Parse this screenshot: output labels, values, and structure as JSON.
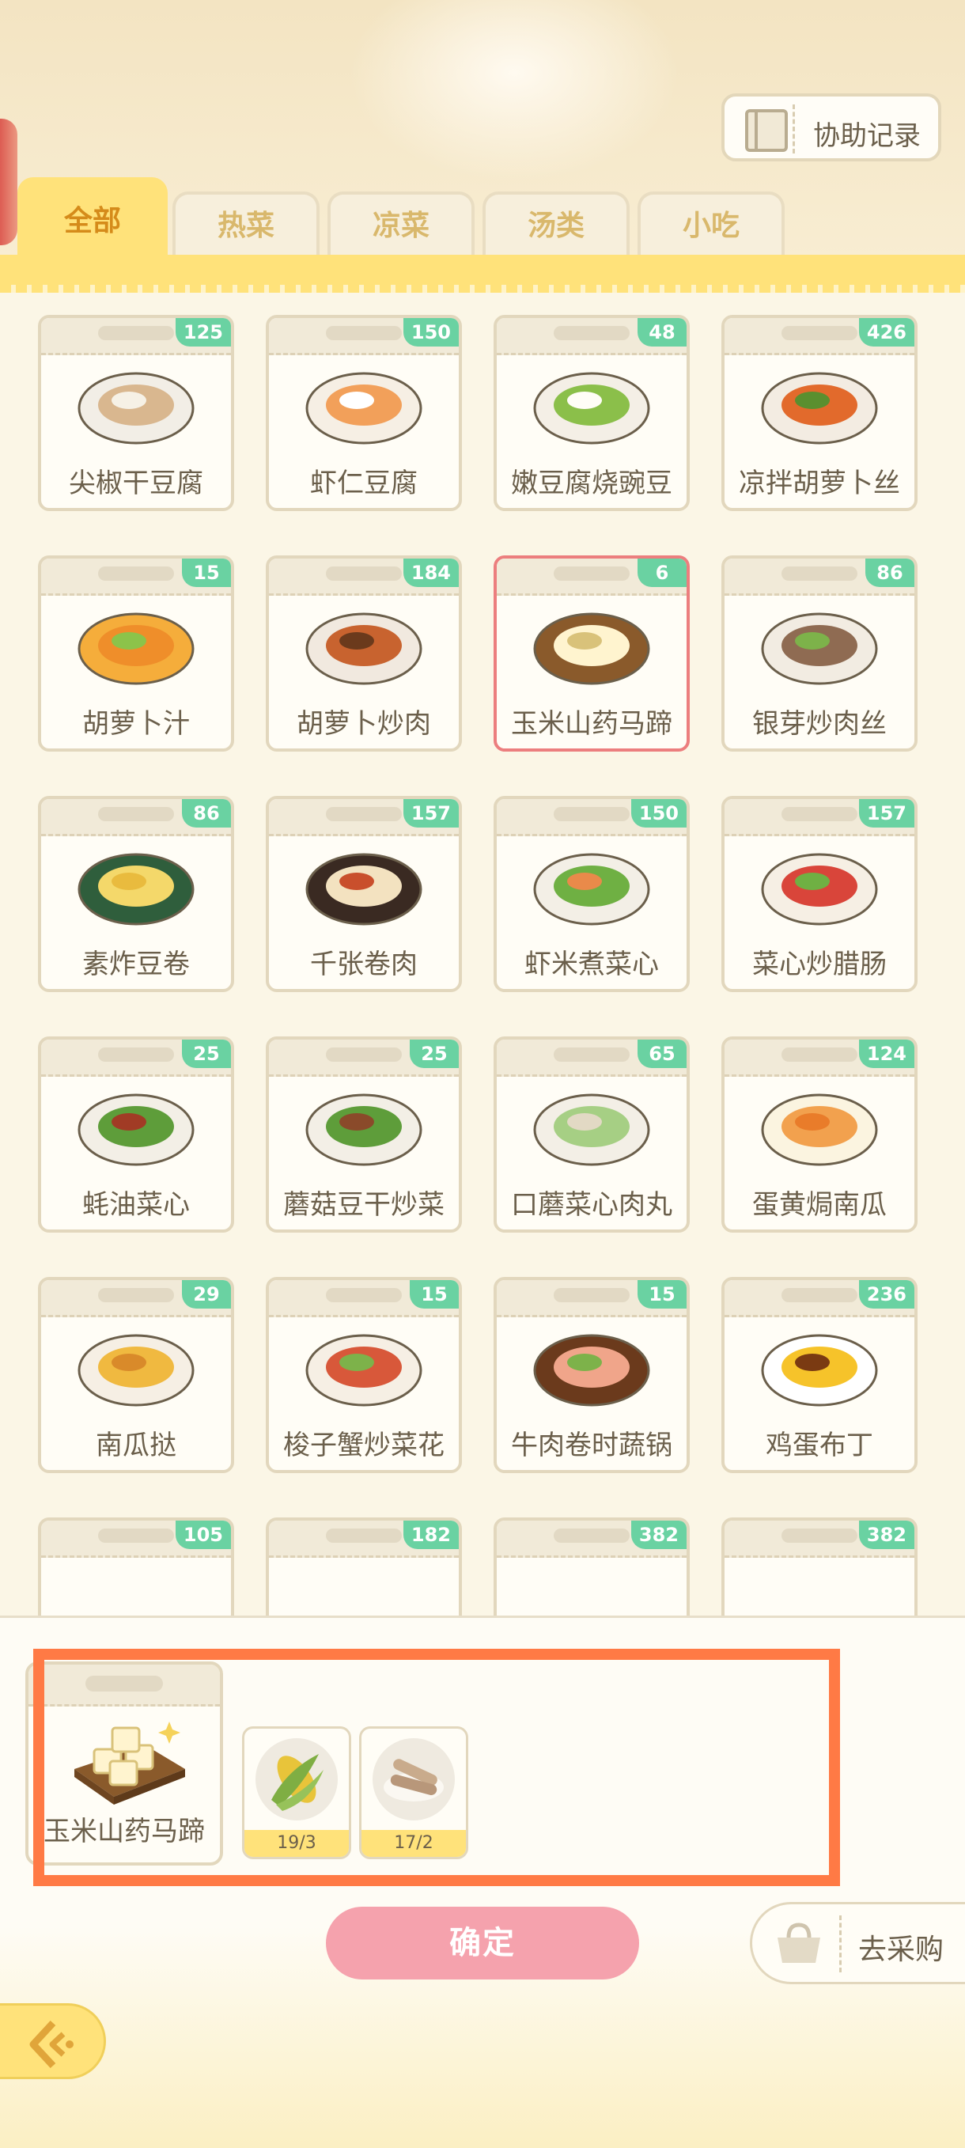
{
  "header": {
    "assist_record_label": "协助记录"
  },
  "tabs": [
    {
      "label": "全部",
      "active": true
    },
    {
      "label": "热菜",
      "active": false
    },
    {
      "label": "凉菜",
      "active": false
    },
    {
      "label": "汤类",
      "active": false
    },
    {
      "label": "小吃",
      "active": false
    }
  ],
  "dishes": [
    {
      "name": "尖椒干豆腐",
      "count": "125"
    },
    {
      "name": "虾仁豆腐",
      "count": "150"
    },
    {
      "name": "嫩豆腐烧豌豆",
      "count": "48"
    },
    {
      "name": "凉拌胡萝卜丝",
      "count": "426"
    },
    {
      "name": "胡萝卜汁",
      "count": "15"
    },
    {
      "name": "胡萝卜炒肉",
      "count": "184"
    },
    {
      "name": "玉米山药马蹄",
      "count": "6",
      "selected": true
    },
    {
      "name": "银芽炒肉丝",
      "count": "86"
    },
    {
      "name": "素炸豆卷",
      "count": "86"
    },
    {
      "name": "千张卷肉",
      "count": "157"
    },
    {
      "name": "虾米煮菜心",
      "count": "150"
    },
    {
      "name": "菜心炒腊肠",
      "count": "157"
    },
    {
      "name": "蚝油菜心",
      "count": "25"
    },
    {
      "name": "蘑菇豆干炒菜",
      "count": "25"
    },
    {
      "name": "口蘑菜心肉丸",
      "count": "65"
    },
    {
      "name": "蛋黄焗南瓜",
      "count": "124"
    },
    {
      "name": "南瓜挞",
      "count": "29"
    },
    {
      "name": "梭子蟹炒菜花",
      "count": "15"
    },
    {
      "name": "牛肉卷时蔬锅",
      "count": "15"
    },
    {
      "name": "鸡蛋布丁",
      "count": "236"
    },
    {
      "name": "",
      "count": "105"
    },
    {
      "name": "",
      "count": "182"
    },
    {
      "name": "",
      "count": "382"
    },
    {
      "name": "",
      "count": "382"
    }
  ],
  "selected_recipe": {
    "name": "玉米山药马蹄",
    "ingredients": [
      {
        "icon": "corn-icon",
        "qty": "19/3"
      },
      {
        "icon": "yam-icon",
        "qty": "17/2"
      }
    ]
  },
  "actions": {
    "confirm_label": "确定",
    "buy_label": "去采购"
  },
  "colors": {
    "accent_yellow": "#ffe27a",
    "badge_green": "#6ad2a2",
    "confirm_pink": "#f5a2ad",
    "highlight_orange": "#ff7a45"
  }
}
